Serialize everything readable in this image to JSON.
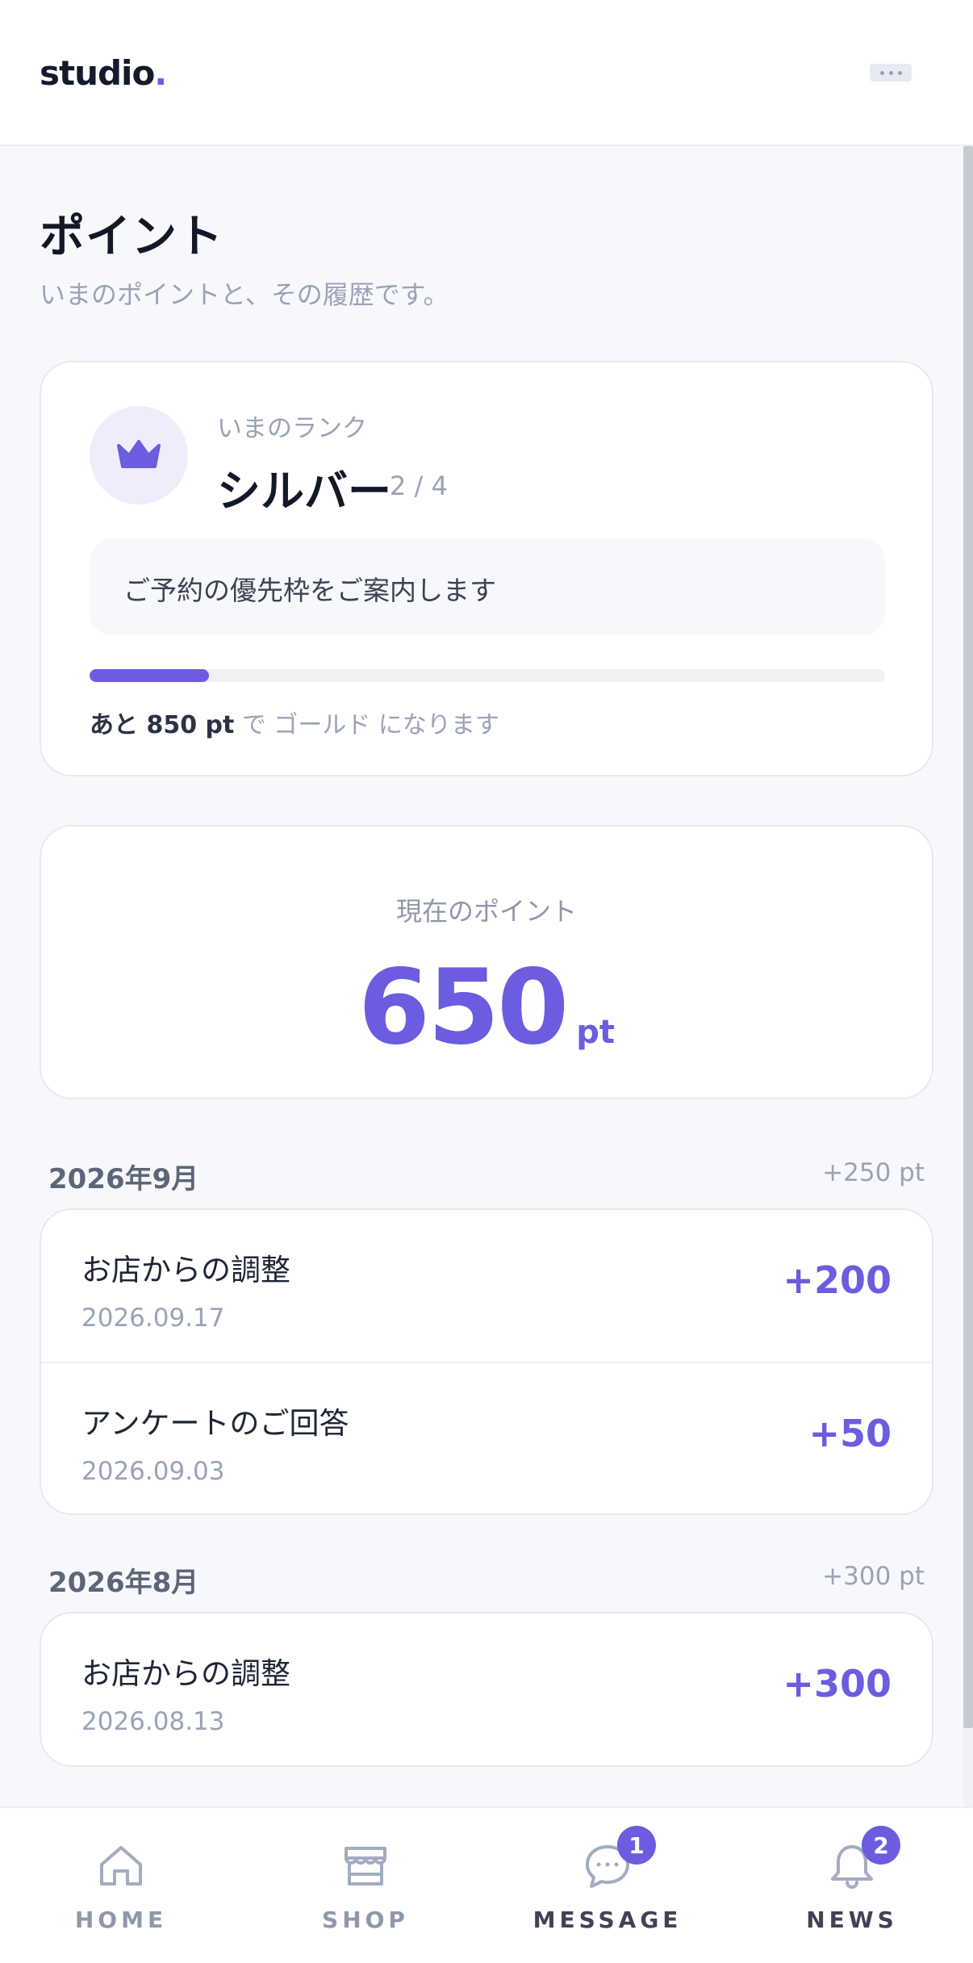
{
  "header": {
    "logo": "studio",
    "logo_dot": ".",
    "menu_icon": "more-horizontal-icon"
  },
  "page": {
    "title": "ポイント",
    "subtitle": "いまのポイントと、その履歴です。"
  },
  "rank": {
    "label": "いまのランク",
    "name": "シルバー",
    "step": "2 / 4",
    "icon": "crown-icon",
    "benefit": "ご予約の優先枠をご案内します",
    "progress_fraction": 0.15,
    "remaining": "あと 850 pt",
    "next_rank_note": " で ゴールド になります"
  },
  "points": {
    "label": "現在のポイント",
    "value": "650",
    "unit": "pt"
  },
  "history": [
    {
      "month": "2026年9月",
      "total": "+250 pt",
      "items": [
        {
          "title": "お店からの調整",
          "date": "2026.09.17",
          "amount": "+200"
        },
        {
          "title": "アンケートのご回答",
          "date": "2026.09.03",
          "amount": "+50"
        }
      ]
    },
    {
      "month": "2026年8月",
      "total": "+300 pt",
      "items": [
        {
          "title": "お店からの調整",
          "date": "2026.08.13",
          "amount": "+300"
        }
      ]
    }
  ],
  "nav": [
    {
      "label": "HOME",
      "icon": "home-icon",
      "badge": ""
    },
    {
      "label": "SHOP",
      "icon": "shop-icon",
      "badge": ""
    },
    {
      "label": "MESSAGE",
      "icon": "message-icon",
      "badge": "1"
    },
    {
      "label": "NEWS",
      "icon": "bell-icon",
      "badge": "2"
    }
  ],
  "colors": {
    "accent": "#6b5ce0",
    "background": "#f7f8fb",
    "muted_text": "#9aa3b6"
  }
}
